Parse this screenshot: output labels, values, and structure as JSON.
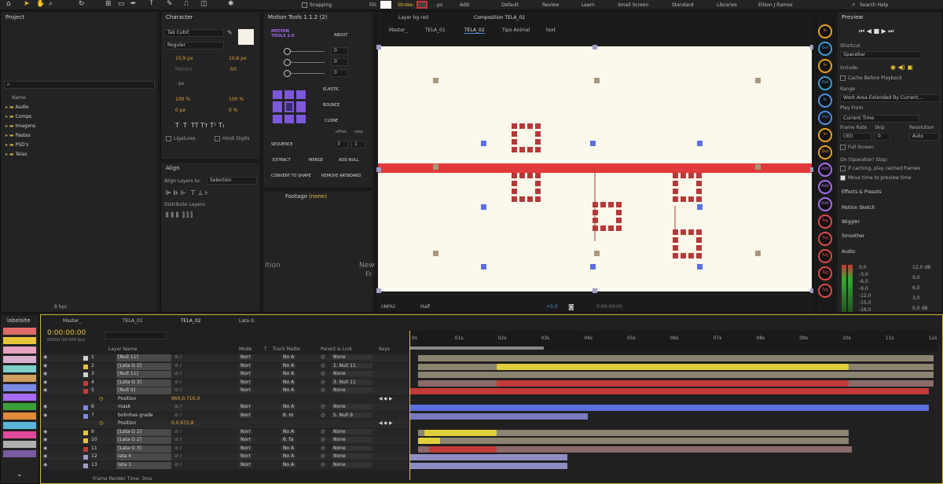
{
  "topbar": {
    "snapping": "Snapping",
    "fill": "Fill:",
    "stroke": "Stroke:",
    "px": "- px",
    "add": "Add:",
    "workspaces": [
      "Default",
      "Review",
      "Learn",
      "Small Screen",
      "Standard",
      "Libraries",
      "Ellson J Ramos"
    ],
    "search": "Search Help"
  },
  "project": {
    "title": "Project",
    "name_col": "Name",
    "items": [
      "Audio",
      "Comps",
      "Imagens",
      "Pastas",
      "PSD's",
      "Telas"
    ],
    "bpc": "8 bpc"
  },
  "character": {
    "title": "Character",
    "font": "Tak Cubit",
    "style": "Regular",
    "size": "10,9 px",
    "leading": "10,6 px",
    "kerning": "Metrics",
    "tracking": "-50",
    "stroke": "- px",
    "scale_v": "100 %",
    "scale_h": "100 %",
    "baseline": "0 px",
    "tsume": "0 %",
    "ligatures": "Ligatures",
    "hindi": "Hindi Digits"
  },
  "align": {
    "title": "Align",
    "align_to_label": "Align Layers to:",
    "align_to": "Selection",
    "distribute": "Distribute Layers:"
  },
  "motion": {
    "title": "Motion Tools 1.1.2 (2)",
    "logo": "MOTION TOOLS 2.0",
    "about": "ABOUT",
    "v1": "0",
    "v2": "0",
    "v3": "0",
    "elastic": "ELASTIC",
    "bounce": "BOUNCE",
    "clone": "CLONE",
    "offset": "offset",
    "step": "step",
    "sequence": "SEQUENCE",
    "seq_a": "3",
    "seq_b": "1",
    "extract": "EXTRACT",
    "merge": "MERGE",
    "add_null": "ADD NULL",
    "convert": "CONVERT TO SHAPE",
    "remove": "REMOVE ARTBOARD"
  },
  "footage": {
    "title": "Footage",
    "none": "(none)",
    "text1": "ition",
    "text2": "New",
    "text3": "Fr"
  },
  "viewer": {
    "tab_layer": "Layer  bg red",
    "tab_comp": "Composition  TELA_02",
    "subtabs": [
      "Master_",
      "TELA_01",
      "TELA_02",
      "Tipo Animal",
      "text"
    ],
    "zoom": "(46%)",
    "res": "Half",
    "exposure": "+0,0",
    "time": "0:00:00:00"
  },
  "preview": {
    "title": "Preview",
    "shortcut_label": "Shortcut",
    "shortcut": "Spacebar",
    "include": "Include:",
    "cache": "Cache Before Playback",
    "range_label": "Range",
    "range": "Work Area Extended By Current...",
    "playfrom_label": "Play From",
    "playfrom": "Current Time",
    "fr_label": "Frame Rate",
    "skip_label": "Skip",
    "resolution_label": "Resolution",
    "fr": "(30)",
    "skip": "0",
    "res": "Auto",
    "fullscreen": "Full Screen",
    "stop": "On (Spacebar) Stop:",
    "if_caching": "If caching, play cached frames",
    "move_time": "Move time to preview time",
    "effects": "Effects & Presets",
    "motion_sketch": "Motion Sketch",
    "wiggler": "Wiggler",
    "smoother": "Smoother",
    "audio": "Audio",
    "db_left": [
      "0,0",
      "-3,0",
      "-6,0",
      "-9,0",
      "-12,0",
      "-15,0",
      "-18,0"
    ],
    "db_right": [
      "12,0 dB",
      "9,0",
      "6,0",
      "3,0",
      "0,0 dB"
    ]
  },
  "toolbar_buttons": [
    "In",
    "Out",
    "In",
    "Out",
    "In",
    "Out",
    "In",
    "Out",
    "Add",
    "Add",
    "Add",
    "Tag",
    "Tag",
    "Tag",
    "Tag",
    "Tag"
  ],
  "labels": {
    "title": "labelsite"
  },
  "timeline": {
    "tabs": [
      "Master_",
      "TELA_01",
      "TELA_02",
      "Lata G"
    ],
    "time": "0:00:00:00",
    "fps": "00000 (30.000 fps)",
    "headers": {
      "layer": "Layer Name",
      "mode": "Mode",
      "t": "T",
      "trkmat": "Track Matte",
      "parent": "Parent & Link",
      "keys": "Keys"
    },
    "ruler": [
      "0s",
      "01s",
      "02s",
      "03s",
      "04s",
      "05s",
      "06s",
      "07s",
      "08s",
      "09s",
      "10s",
      "11s",
      "12s"
    ],
    "render": "Frame Render Time: 3ms",
    "rows": [
      {
        "num": "1",
        "name": "[Null 11]",
        "mode": "Norr",
        "matte": "No A",
        "parent": "None"
      },
      {
        "num": "2",
        "name": "[Lata G 2]",
        "mode": "Norr",
        "matte": "No A",
        "parent": "1. Null 11"
      },
      {
        "num": "3",
        "name": "[Null 11]",
        "mode": "Norr",
        "matte": "No A",
        "parent": "None"
      },
      {
        "num": "4",
        "name": "[Lata G 3]",
        "mode": "Norr",
        "matte": "No A",
        "parent": "3. Null 11"
      },
      {
        "num": "5",
        "name": "[Null 9]",
        "mode": "Norr",
        "matte": "No A",
        "parent": "None"
      },
      {
        "num": "",
        "name": "Position",
        "value": "960,0,716,0"
      },
      {
        "num": "6",
        "name": "mask",
        "mode": "Norr",
        "matte": "No A",
        "parent": "None"
      },
      {
        "num": "7",
        "name": "bolinhas grade",
        "mode": "Norr",
        "matte": "6. m",
        "parent": "5. Null 9"
      },
      {
        "num": "",
        "name": "Position",
        "value": "0,0,672,8"
      },
      {
        "num": "9",
        "name": "[Lata G 2]",
        "mode": "Norr",
        "matte": "No A",
        "parent": "None"
      },
      {
        "num": "10",
        "name": "[Lata G 2]",
        "mode": "Norr",
        "matte": "8. fa",
        "parent": "None"
      },
      {
        "num": "11",
        "name": "[Lata G 3]",
        "mode": "Norr",
        "matte": "No A",
        "parent": "None"
      },
      {
        "num": "12",
        "name": "lata 4",
        "mode": "Norr",
        "matte": "No A",
        "parent": "None"
      },
      {
        "num": "13",
        "name": "lata 1",
        "mode": "Norr",
        "matte": "No A",
        "parent": "None"
      }
    ]
  }
}
